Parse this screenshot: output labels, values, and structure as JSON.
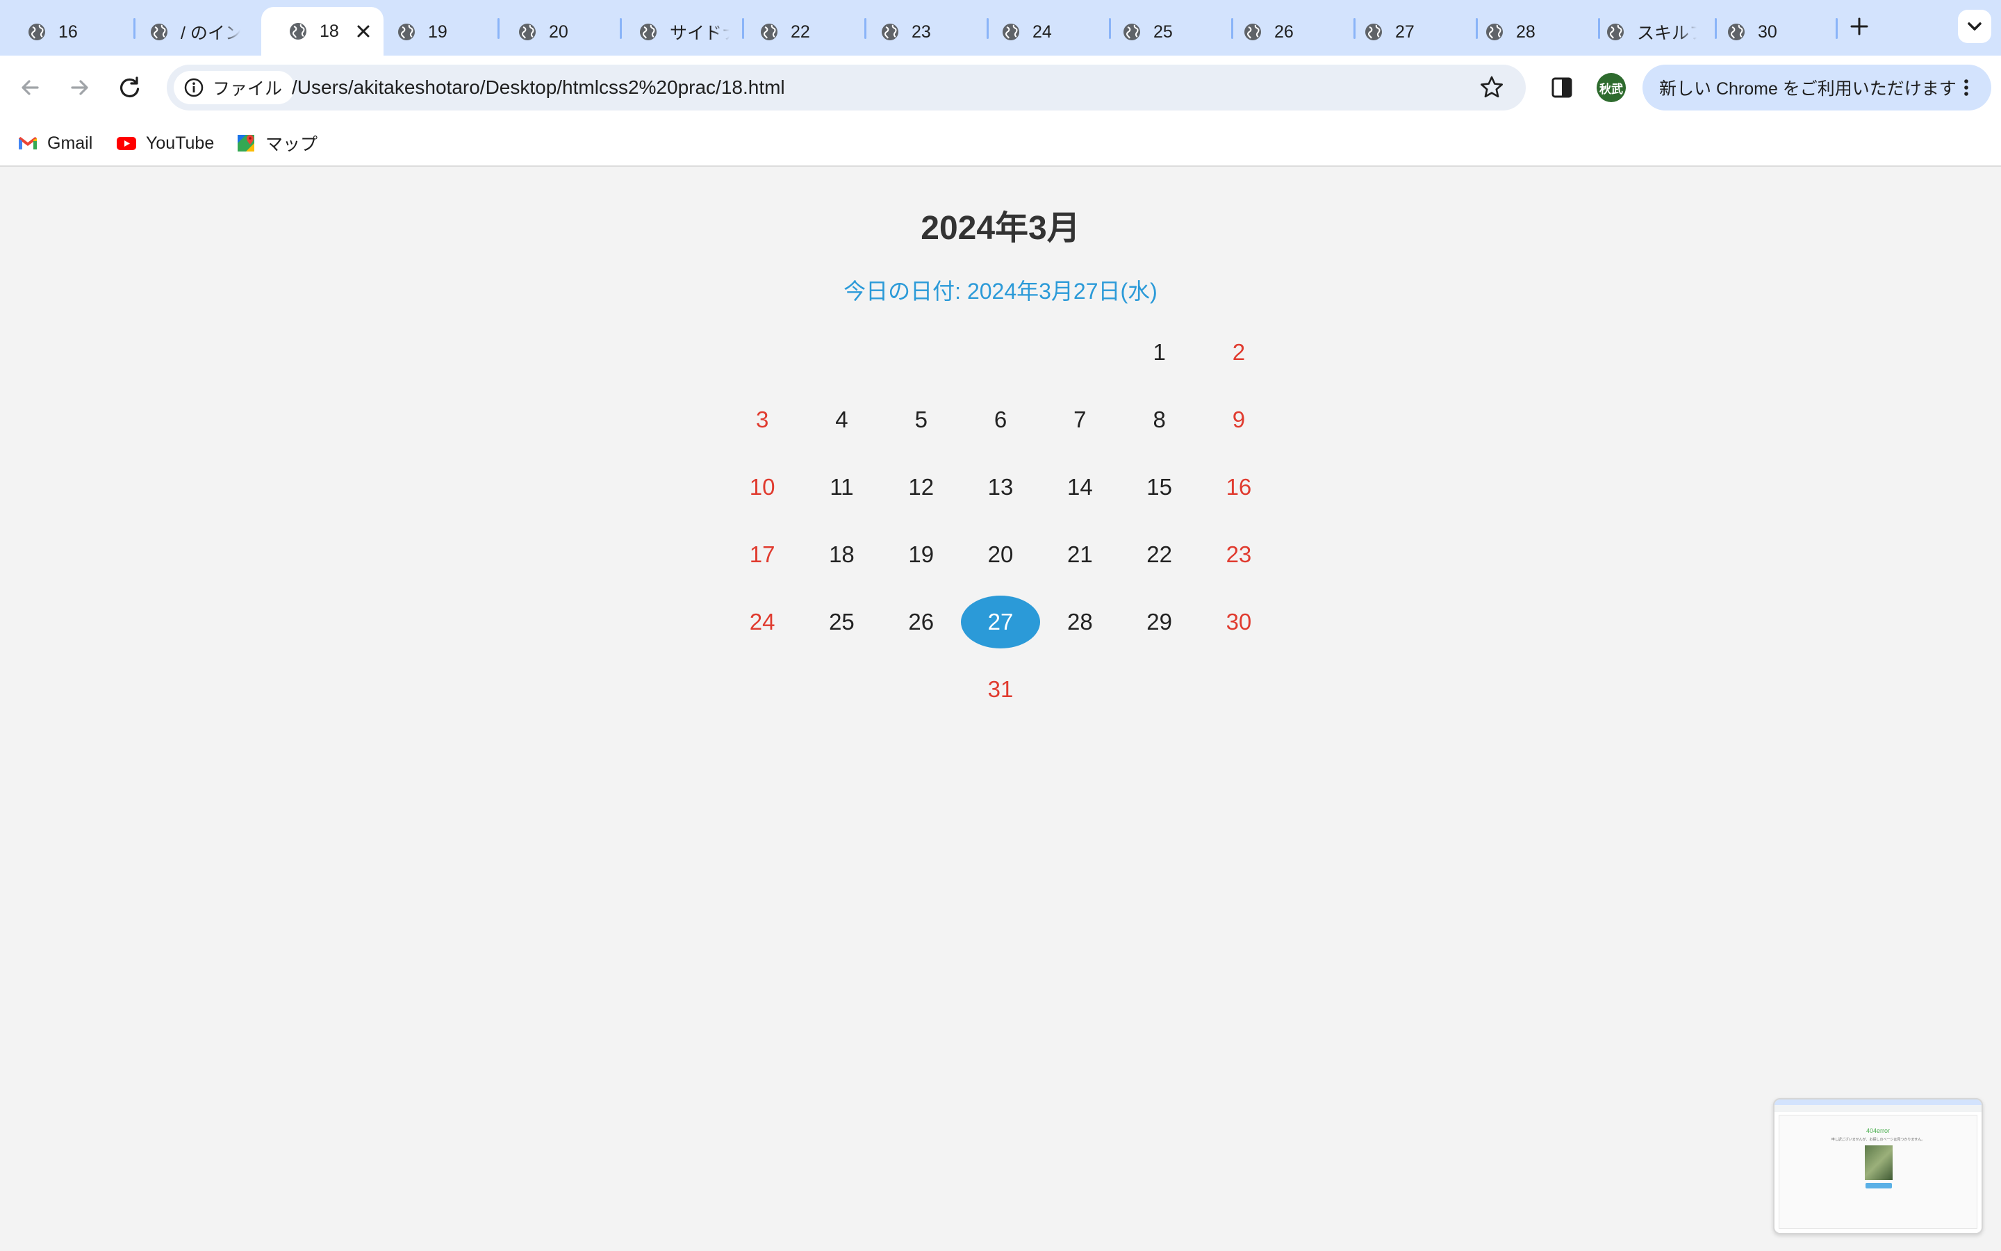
{
  "browser": {
    "tabs": [
      {
        "title": "16",
        "active": false
      },
      {
        "title": "/ のイン",
        "active": false
      },
      {
        "title": "18",
        "active": true
      },
      {
        "title": "19",
        "active": false
      },
      {
        "title": "20",
        "active": false
      },
      {
        "title": "サイドナ",
        "active": false
      },
      {
        "title": "22",
        "active": false
      },
      {
        "title": "23",
        "active": false
      },
      {
        "title": "24",
        "active": false
      },
      {
        "title": "25",
        "active": false
      },
      {
        "title": "26",
        "active": false
      },
      {
        "title": "27",
        "active": false
      },
      {
        "title": "28",
        "active": false
      },
      {
        "title": "スキルフ",
        "active": false
      },
      {
        "title": "30",
        "active": false
      }
    ],
    "address_chip": "ファイル",
    "url": "/Users/akitakeshotaro/Desktop/htmlcss2%20prac/18.html",
    "avatar_text": "秋武",
    "update_button": "新しい Chrome をご利用いただけます",
    "bookmarks": [
      {
        "label": "Gmail",
        "icon": "gmail-icon"
      },
      {
        "label": "YouTube",
        "icon": "youtube-icon"
      },
      {
        "label": "マップ",
        "icon": "maps-icon"
      }
    ],
    "colors": {
      "tabstrip": "#d3e3fd",
      "accent": "#2b9ad8",
      "weekend": "#e03b2f"
    }
  },
  "calendar": {
    "title": "2024年3月",
    "today_line": "今日の日付: 2024年3月27日(水)",
    "today": "27",
    "weeks": [
      [
        "",
        "",
        "",
        "",
        "",
        "1",
        "2"
      ],
      [
        "3",
        "4",
        "5",
        "6",
        "7",
        "8",
        "9"
      ],
      [
        "10",
        "11",
        "12",
        "13",
        "14",
        "15",
        "16"
      ],
      [
        "17",
        "18",
        "19",
        "20",
        "21",
        "22",
        "23"
      ],
      [
        "24",
        "25",
        "26",
        "27",
        "28",
        "29",
        "30"
      ],
      [
        "",
        "",
        "",
        "31",
        "",
        "",
        ""
      ]
    ],
    "red_days": [
      "2",
      "3",
      "9",
      "10",
      "16",
      "17",
      "23",
      "24",
      "30",
      "31"
    ]
  },
  "thumbnail": {
    "title": "404error",
    "subtitle": "申し訳ございませんが、お探しのページは見つかりません。"
  }
}
